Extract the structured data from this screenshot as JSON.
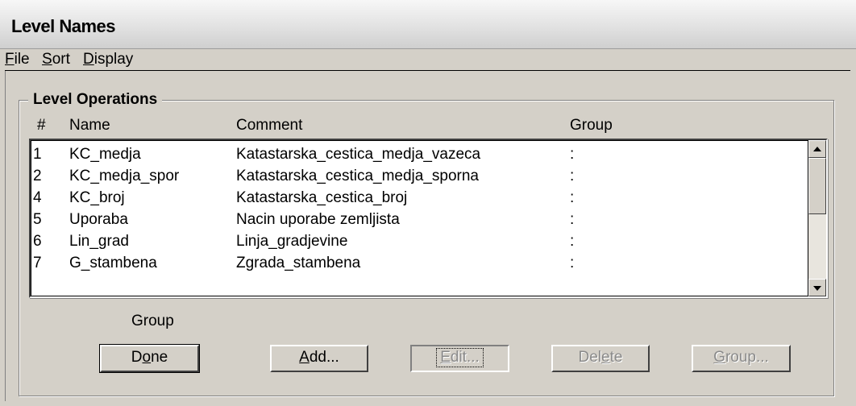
{
  "window": {
    "title": "Level Names"
  },
  "menu": [
    {
      "label": "File",
      "key": "F",
      "rest": "ile"
    },
    {
      "label": "Sort",
      "key": "S",
      "rest": "ort"
    },
    {
      "label": "Display",
      "key": "D",
      "rest": "isplay"
    }
  ],
  "level_operations": {
    "label": "Level Operations",
    "columns": {
      "num": "#",
      "name": "Name",
      "comment": "Comment",
      "group": "Group"
    },
    "rows": [
      {
        "num": "1",
        "name": "KC_medja",
        "comment": "Katastarska_cestica_medja_vazeca",
        "group": ":"
      },
      {
        "num": "2",
        "name": "KC_medja_spor",
        "comment": "Katastarska_cestica_medja_sporna",
        "group": ":"
      },
      {
        "num": "4",
        "name": "KC_broj",
        "comment": "Katastarska_cestica_broj",
        "group": ":"
      },
      {
        "num": "5",
        "name": "Uporaba",
        "comment": "Nacin uporabe zemljista",
        "group": ":"
      },
      {
        "num": "6",
        "name": "Lin_grad",
        "comment": "Linja_gradjevine",
        "group": ":"
      },
      {
        "num": "7",
        "name": "G_stambena",
        "comment": "Zgrada_stambena",
        "group": ":"
      }
    ],
    "group_label": "Group"
  },
  "buttons": {
    "done": {
      "pre": "D",
      "key": "o",
      "post": "ne"
    },
    "add": {
      "pre": "",
      "key": "A",
      "post": "dd..."
    },
    "edit": {
      "pre": "",
      "key": "E",
      "post": "dit..."
    },
    "delete": {
      "pre": "Del",
      "key": "e",
      "post": "te"
    },
    "group": {
      "pre": "",
      "key": "G",
      "post": "roup..."
    }
  }
}
